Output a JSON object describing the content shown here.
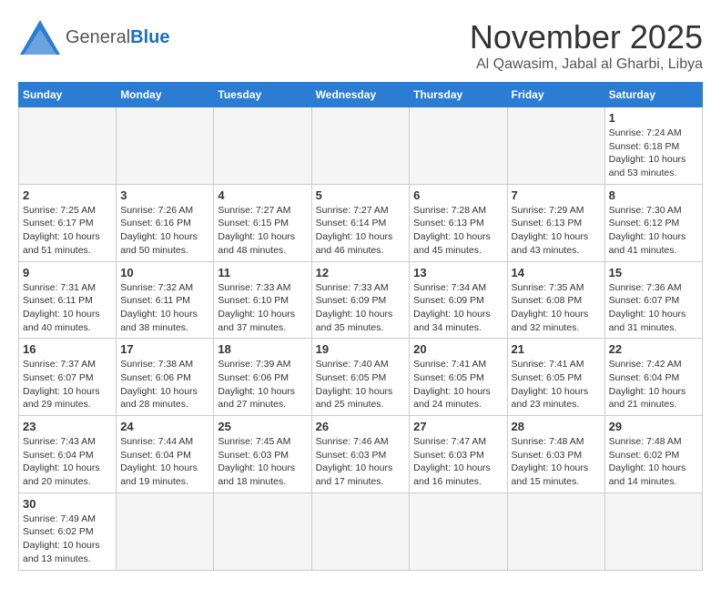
{
  "header": {
    "logo_general": "General",
    "logo_blue": "Blue",
    "month_title": "November 2025",
    "location": "Al Qawasim, Jabal al Gharbi, Libya"
  },
  "days_of_week": [
    "Sunday",
    "Monday",
    "Tuesday",
    "Wednesday",
    "Thursday",
    "Friday",
    "Saturday"
  ],
  "weeks": [
    [
      {
        "day": "",
        "info": ""
      },
      {
        "day": "",
        "info": ""
      },
      {
        "day": "",
        "info": ""
      },
      {
        "day": "",
        "info": ""
      },
      {
        "day": "",
        "info": ""
      },
      {
        "day": "",
        "info": ""
      },
      {
        "day": "1",
        "info": "Sunrise: 7:24 AM\nSunset: 6:18 PM\nDaylight: 10 hours and 53 minutes."
      }
    ],
    [
      {
        "day": "2",
        "info": "Sunrise: 7:25 AM\nSunset: 6:17 PM\nDaylight: 10 hours and 51 minutes."
      },
      {
        "day": "3",
        "info": "Sunrise: 7:26 AM\nSunset: 6:16 PM\nDaylight: 10 hours and 50 minutes."
      },
      {
        "day": "4",
        "info": "Sunrise: 7:27 AM\nSunset: 6:15 PM\nDaylight: 10 hours and 48 minutes."
      },
      {
        "day": "5",
        "info": "Sunrise: 7:27 AM\nSunset: 6:14 PM\nDaylight: 10 hours and 46 minutes."
      },
      {
        "day": "6",
        "info": "Sunrise: 7:28 AM\nSunset: 6:13 PM\nDaylight: 10 hours and 45 minutes."
      },
      {
        "day": "7",
        "info": "Sunrise: 7:29 AM\nSunset: 6:13 PM\nDaylight: 10 hours and 43 minutes."
      },
      {
        "day": "8",
        "info": "Sunrise: 7:30 AM\nSunset: 6:12 PM\nDaylight: 10 hours and 41 minutes."
      }
    ],
    [
      {
        "day": "9",
        "info": "Sunrise: 7:31 AM\nSunset: 6:11 PM\nDaylight: 10 hours and 40 minutes."
      },
      {
        "day": "10",
        "info": "Sunrise: 7:32 AM\nSunset: 6:11 PM\nDaylight: 10 hours and 38 minutes."
      },
      {
        "day": "11",
        "info": "Sunrise: 7:33 AM\nSunset: 6:10 PM\nDaylight: 10 hours and 37 minutes."
      },
      {
        "day": "12",
        "info": "Sunrise: 7:33 AM\nSunset: 6:09 PM\nDaylight: 10 hours and 35 minutes."
      },
      {
        "day": "13",
        "info": "Sunrise: 7:34 AM\nSunset: 6:09 PM\nDaylight: 10 hours and 34 minutes."
      },
      {
        "day": "14",
        "info": "Sunrise: 7:35 AM\nSunset: 6:08 PM\nDaylight: 10 hours and 32 minutes."
      },
      {
        "day": "15",
        "info": "Sunrise: 7:36 AM\nSunset: 6:07 PM\nDaylight: 10 hours and 31 minutes."
      }
    ],
    [
      {
        "day": "16",
        "info": "Sunrise: 7:37 AM\nSunset: 6:07 PM\nDaylight: 10 hours and 29 minutes."
      },
      {
        "day": "17",
        "info": "Sunrise: 7:38 AM\nSunset: 6:06 PM\nDaylight: 10 hours and 28 minutes."
      },
      {
        "day": "18",
        "info": "Sunrise: 7:39 AM\nSunset: 6:06 PM\nDaylight: 10 hours and 27 minutes."
      },
      {
        "day": "19",
        "info": "Sunrise: 7:40 AM\nSunset: 6:05 PM\nDaylight: 10 hours and 25 minutes."
      },
      {
        "day": "20",
        "info": "Sunrise: 7:41 AM\nSunset: 6:05 PM\nDaylight: 10 hours and 24 minutes."
      },
      {
        "day": "21",
        "info": "Sunrise: 7:41 AM\nSunset: 6:05 PM\nDaylight: 10 hours and 23 minutes."
      },
      {
        "day": "22",
        "info": "Sunrise: 7:42 AM\nSunset: 6:04 PM\nDaylight: 10 hours and 21 minutes."
      }
    ],
    [
      {
        "day": "23",
        "info": "Sunrise: 7:43 AM\nSunset: 6:04 PM\nDaylight: 10 hours and 20 minutes."
      },
      {
        "day": "24",
        "info": "Sunrise: 7:44 AM\nSunset: 6:04 PM\nDaylight: 10 hours and 19 minutes."
      },
      {
        "day": "25",
        "info": "Sunrise: 7:45 AM\nSunset: 6:03 PM\nDaylight: 10 hours and 18 minutes."
      },
      {
        "day": "26",
        "info": "Sunrise: 7:46 AM\nSunset: 6:03 PM\nDaylight: 10 hours and 17 minutes."
      },
      {
        "day": "27",
        "info": "Sunrise: 7:47 AM\nSunset: 6:03 PM\nDaylight: 10 hours and 16 minutes."
      },
      {
        "day": "28",
        "info": "Sunrise: 7:48 AM\nSunset: 6:03 PM\nDaylight: 10 hours and 15 minutes."
      },
      {
        "day": "29",
        "info": "Sunrise: 7:48 AM\nSunset: 6:02 PM\nDaylight: 10 hours and 14 minutes."
      }
    ],
    [
      {
        "day": "30",
        "info": "Sunrise: 7:49 AM\nSunset: 6:02 PM\nDaylight: 10 hours and 13 minutes."
      },
      {
        "day": "",
        "info": ""
      },
      {
        "day": "",
        "info": ""
      },
      {
        "day": "",
        "info": ""
      },
      {
        "day": "",
        "info": ""
      },
      {
        "day": "",
        "info": ""
      },
      {
        "day": "",
        "info": ""
      }
    ]
  ]
}
